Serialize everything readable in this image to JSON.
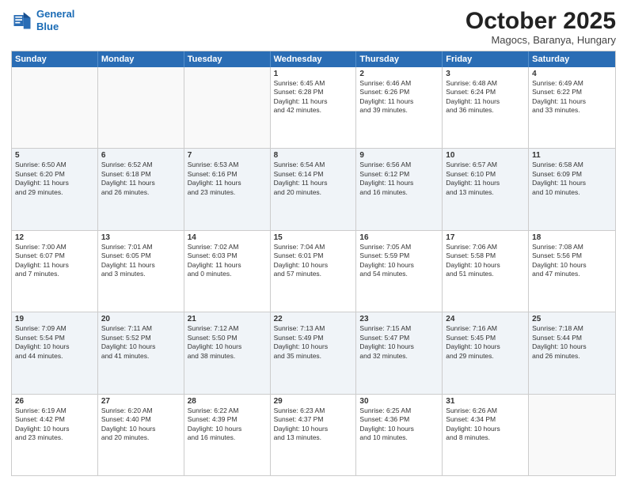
{
  "header": {
    "logo_line1": "General",
    "logo_line2": "Blue",
    "month_title": "October 2025",
    "subtitle": "Magocs, Baranya, Hungary"
  },
  "calendar": {
    "days": [
      "Sunday",
      "Monday",
      "Tuesday",
      "Wednesday",
      "Thursday",
      "Friday",
      "Saturday"
    ],
    "rows": [
      [
        {
          "date": "",
          "info": ""
        },
        {
          "date": "",
          "info": ""
        },
        {
          "date": "",
          "info": ""
        },
        {
          "date": "1",
          "info": "Sunrise: 6:45 AM\nSunset: 6:28 PM\nDaylight: 11 hours\nand 42 minutes."
        },
        {
          "date": "2",
          "info": "Sunrise: 6:46 AM\nSunset: 6:26 PM\nDaylight: 11 hours\nand 39 minutes."
        },
        {
          "date": "3",
          "info": "Sunrise: 6:48 AM\nSunset: 6:24 PM\nDaylight: 11 hours\nand 36 minutes."
        },
        {
          "date": "4",
          "info": "Sunrise: 6:49 AM\nSunset: 6:22 PM\nDaylight: 11 hours\nand 33 minutes."
        }
      ],
      [
        {
          "date": "5",
          "info": "Sunrise: 6:50 AM\nSunset: 6:20 PM\nDaylight: 11 hours\nand 29 minutes."
        },
        {
          "date": "6",
          "info": "Sunrise: 6:52 AM\nSunset: 6:18 PM\nDaylight: 11 hours\nand 26 minutes."
        },
        {
          "date": "7",
          "info": "Sunrise: 6:53 AM\nSunset: 6:16 PM\nDaylight: 11 hours\nand 23 minutes."
        },
        {
          "date": "8",
          "info": "Sunrise: 6:54 AM\nSunset: 6:14 PM\nDaylight: 11 hours\nand 20 minutes."
        },
        {
          "date": "9",
          "info": "Sunrise: 6:56 AM\nSunset: 6:12 PM\nDaylight: 11 hours\nand 16 minutes."
        },
        {
          "date": "10",
          "info": "Sunrise: 6:57 AM\nSunset: 6:10 PM\nDaylight: 11 hours\nand 13 minutes."
        },
        {
          "date": "11",
          "info": "Sunrise: 6:58 AM\nSunset: 6:09 PM\nDaylight: 11 hours\nand 10 minutes."
        }
      ],
      [
        {
          "date": "12",
          "info": "Sunrise: 7:00 AM\nSunset: 6:07 PM\nDaylight: 11 hours\nand 7 minutes."
        },
        {
          "date": "13",
          "info": "Sunrise: 7:01 AM\nSunset: 6:05 PM\nDaylight: 11 hours\nand 3 minutes."
        },
        {
          "date": "14",
          "info": "Sunrise: 7:02 AM\nSunset: 6:03 PM\nDaylight: 11 hours\nand 0 minutes."
        },
        {
          "date": "15",
          "info": "Sunrise: 7:04 AM\nSunset: 6:01 PM\nDaylight: 10 hours\nand 57 minutes."
        },
        {
          "date": "16",
          "info": "Sunrise: 7:05 AM\nSunset: 5:59 PM\nDaylight: 10 hours\nand 54 minutes."
        },
        {
          "date": "17",
          "info": "Sunrise: 7:06 AM\nSunset: 5:58 PM\nDaylight: 10 hours\nand 51 minutes."
        },
        {
          "date": "18",
          "info": "Sunrise: 7:08 AM\nSunset: 5:56 PM\nDaylight: 10 hours\nand 47 minutes."
        }
      ],
      [
        {
          "date": "19",
          "info": "Sunrise: 7:09 AM\nSunset: 5:54 PM\nDaylight: 10 hours\nand 44 minutes."
        },
        {
          "date": "20",
          "info": "Sunrise: 7:11 AM\nSunset: 5:52 PM\nDaylight: 10 hours\nand 41 minutes."
        },
        {
          "date": "21",
          "info": "Sunrise: 7:12 AM\nSunset: 5:50 PM\nDaylight: 10 hours\nand 38 minutes."
        },
        {
          "date": "22",
          "info": "Sunrise: 7:13 AM\nSunset: 5:49 PM\nDaylight: 10 hours\nand 35 minutes."
        },
        {
          "date": "23",
          "info": "Sunrise: 7:15 AM\nSunset: 5:47 PM\nDaylight: 10 hours\nand 32 minutes."
        },
        {
          "date": "24",
          "info": "Sunrise: 7:16 AM\nSunset: 5:45 PM\nDaylight: 10 hours\nand 29 minutes."
        },
        {
          "date": "25",
          "info": "Sunrise: 7:18 AM\nSunset: 5:44 PM\nDaylight: 10 hours\nand 26 minutes."
        }
      ],
      [
        {
          "date": "26",
          "info": "Sunrise: 6:19 AM\nSunset: 4:42 PM\nDaylight: 10 hours\nand 23 minutes."
        },
        {
          "date": "27",
          "info": "Sunrise: 6:20 AM\nSunset: 4:40 PM\nDaylight: 10 hours\nand 20 minutes."
        },
        {
          "date": "28",
          "info": "Sunrise: 6:22 AM\nSunset: 4:39 PM\nDaylight: 10 hours\nand 16 minutes."
        },
        {
          "date": "29",
          "info": "Sunrise: 6:23 AM\nSunset: 4:37 PM\nDaylight: 10 hours\nand 13 minutes."
        },
        {
          "date": "30",
          "info": "Sunrise: 6:25 AM\nSunset: 4:36 PM\nDaylight: 10 hours\nand 10 minutes."
        },
        {
          "date": "31",
          "info": "Sunrise: 6:26 AM\nSunset: 4:34 PM\nDaylight: 10 hours\nand 8 minutes."
        },
        {
          "date": "",
          "info": ""
        }
      ]
    ]
  }
}
